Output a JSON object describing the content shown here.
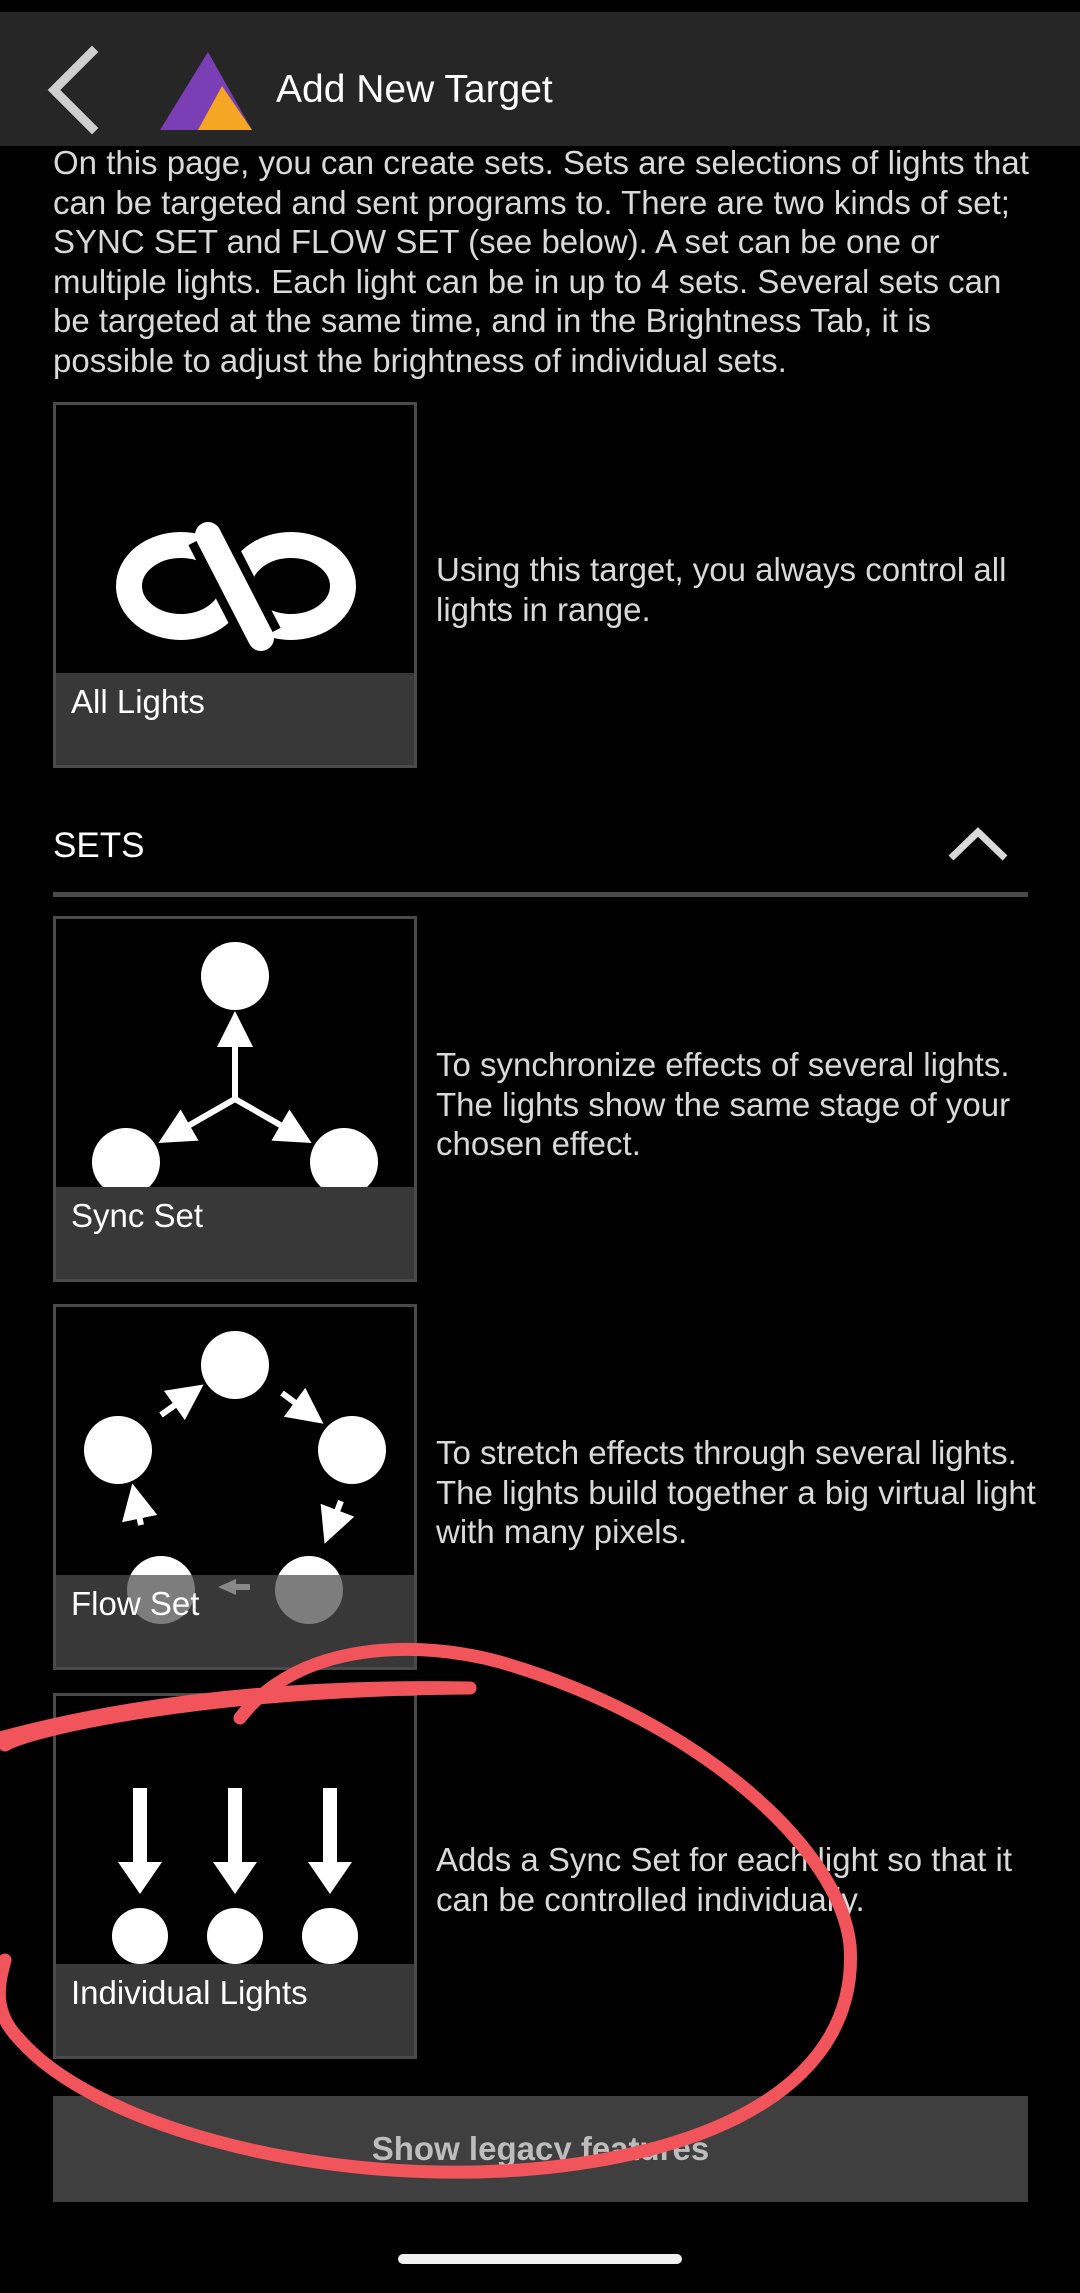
{
  "app_bar": {
    "title": "Add New Target",
    "back_icon": "chevron-left-icon",
    "logo_icon": "app-logo-icon"
  },
  "intro_text": "On this page, you can create sets. Sets are selections of lights that can be targeted and sent programs to. There are two kinds of set; SYNC SET and FLOW SET (see below). A set can be one or multiple lights. Each light can be in up to 4 sets. Several sets can be targeted at the same time, and in the Brightness Tab, it is possible to adjust the brightness of individual sets.",
  "all_lights": {
    "label": "All Lights",
    "description": "Using this target, you always control all lights in range."
  },
  "sets_section": {
    "title": "SETS",
    "collapse_icon": "chevron-up-icon"
  },
  "sets": [
    {
      "label": "Sync Set",
      "description": "To synchronize effects of several lights. The lights show the same stage of your chosen effect."
    },
    {
      "label": "Flow Set",
      "description": "To stretch effects through several lights. The lights build together a big virtual light with many pixels."
    },
    {
      "label": "Individual Lights",
      "description": "Adds a Sync Set for each light so that it can be controlled individually."
    }
  ],
  "legacy_button": "Show legacy features",
  "colors": {
    "app_bar_bg": "#262626",
    "card_label_bg": "#383838",
    "annotation_red": "#f2545b",
    "logo_purple": "#7b3fb5",
    "logo_orange": "#f5a623"
  }
}
